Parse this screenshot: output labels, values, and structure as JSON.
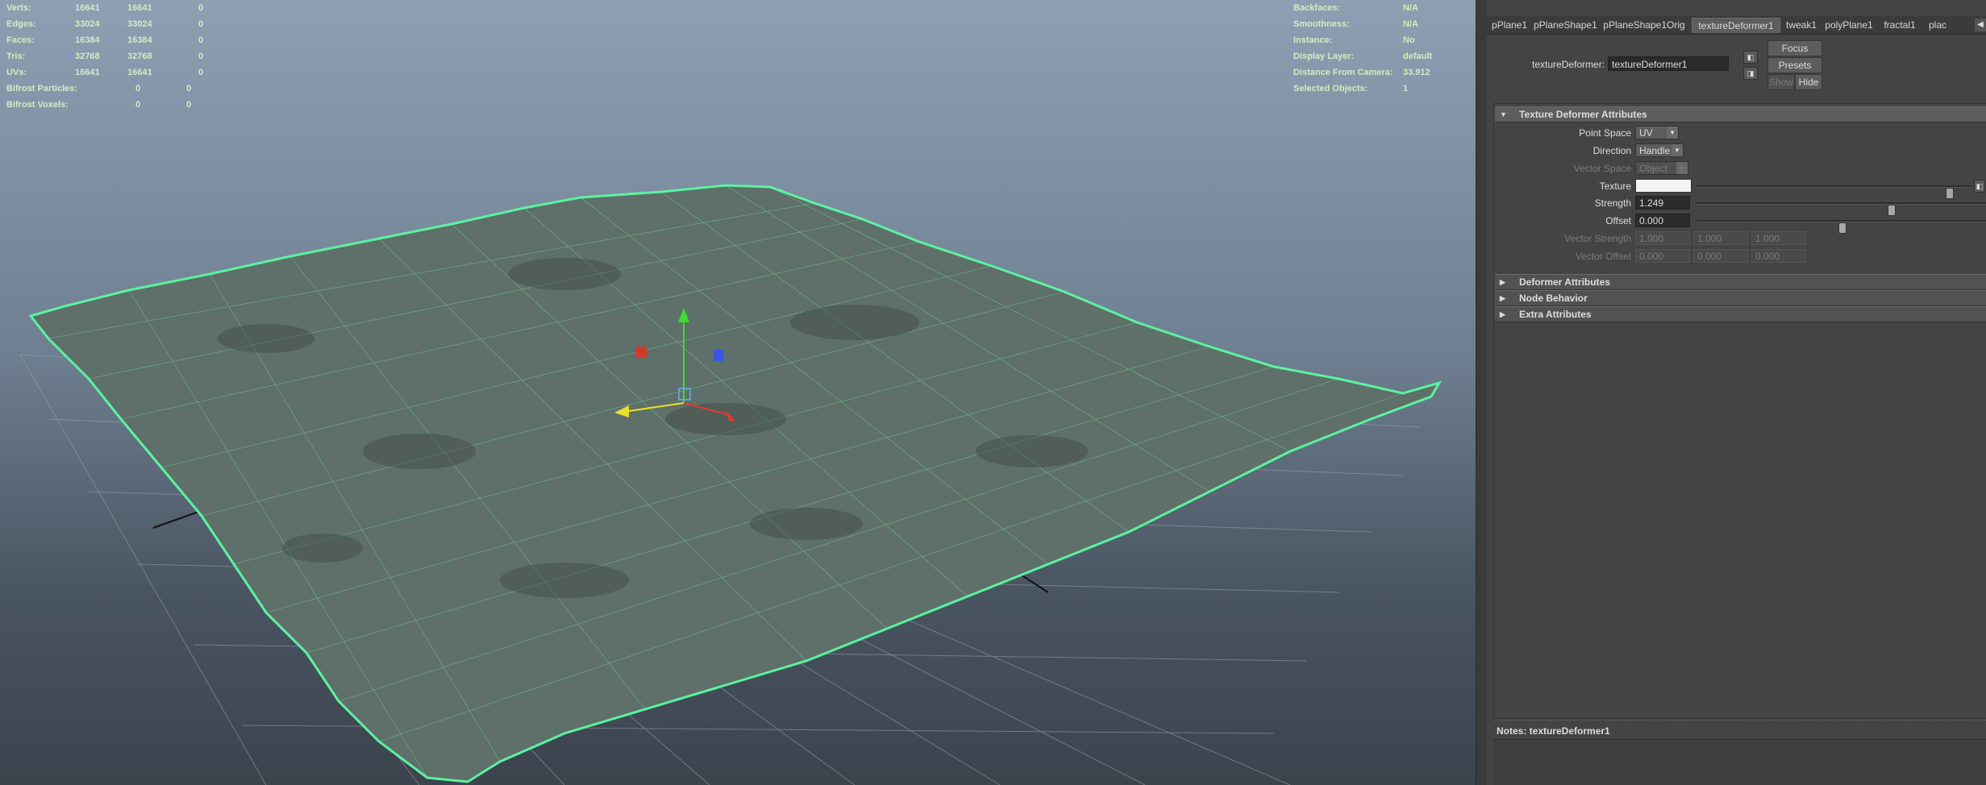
{
  "hud_left": {
    "rows": [
      {
        "label": "Verts:",
        "a": "16641",
        "b": "16641",
        "c": "0"
      },
      {
        "label": "Edges:",
        "a": "33024",
        "b": "33024",
        "c": "0"
      },
      {
        "label": "Faces:",
        "a": "16384",
        "b": "16384",
        "c": "0"
      },
      {
        "label": "Tris:",
        "a": "32768",
        "b": "32768",
        "c": "0"
      },
      {
        "label": "UVs:",
        "a": "16641",
        "b": "16641",
        "c": "0"
      },
      {
        "label": "Bifrost Particles:",
        "a": "",
        "b": "0",
        "c": "0"
      },
      {
        "label": "Bifrost Voxels:",
        "a": "",
        "b": "0",
        "c": "0"
      }
    ]
  },
  "hud_right": {
    "rows": [
      {
        "label": "Backfaces:",
        "value": "N/A"
      },
      {
        "label": "Smoothness:",
        "value": "N/A"
      },
      {
        "label": "Instance:",
        "value": "No"
      },
      {
        "label": "Display Layer:",
        "value": "default"
      },
      {
        "label": "Distance From Camera:",
        "value": "33.912"
      },
      {
        "label": "Selected Objects:",
        "value": "1"
      }
    ]
  },
  "tabs": [
    "pPlane1",
    "pPlaneShape1",
    "pPlaneShape1Orig",
    "textureDeformer1",
    "tweak1",
    "polyPlane1",
    "fractal1",
    "plac"
  ],
  "active_tab": "textureDeformer1",
  "node": {
    "label": "textureDeformer:",
    "value": "textureDeformer1"
  },
  "buttons": {
    "focus": "Focus",
    "presets": "Presets",
    "show": "Show",
    "hide": "Hide"
  },
  "sections": {
    "texture_deformer": "Texture Deformer Attributes",
    "deformer": "Deformer Attributes",
    "node_behavior": "Node Behavior",
    "extra": "Extra Attributes"
  },
  "attributes": {
    "point_space": {
      "label": "Point Space",
      "value": "UV"
    },
    "direction": {
      "label": "Direction",
      "value": "Handle"
    },
    "vector_space": {
      "label": "Vector Space",
      "value": "Object"
    },
    "texture": {
      "label": "Texture",
      "slider_level": 0.92
    },
    "strength": {
      "label": "Strength",
      "value": "1.249",
      "slider_level": 0.67
    },
    "offset": {
      "label": "Offset",
      "value": "0.000",
      "slider_level": 0.5
    },
    "vector_strength": {
      "label": "Vector Strength",
      "values": [
        "1.000",
        "1.000",
        "1.000"
      ]
    },
    "vector_offset": {
      "label": "Vector Offset",
      "values": [
        "0.000",
        "0.000",
        "0.000"
      ]
    }
  },
  "notes": {
    "label": "Notes:  textureDeformer1"
  },
  "colors": {
    "wire_selected": "#5cf2a0",
    "mesh_fill": "#5f6f69",
    "viewport_top": "#8da0b3",
    "panel_bg": "#444444"
  }
}
